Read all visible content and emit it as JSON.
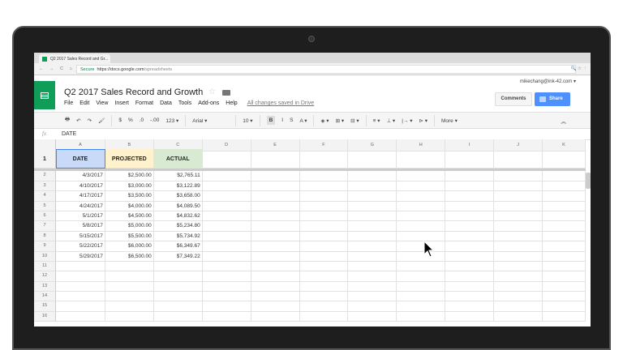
{
  "browser": {
    "tab_title": "Q2 2017 Sales Record and Gr...",
    "secure": "Secure",
    "url_host": "https://docs.google.com",
    "url_path": "/spreadsheets"
  },
  "doc": {
    "title": "Q2 2017 Sales Record and Growth",
    "user": "mikechang@ink-42.com ▾",
    "comments": "Comments",
    "share": "Share",
    "menu": [
      "File",
      "Edit",
      "View",
      "Insert",
      "Format",
      "Data",
      "Tools",
      "Add-ons",
      "Help"
    ],
    "saved": "All changes saved in Drive"
  },
  "toolbar": {
    "items": [
      "🖶",
      "↶",
      "↷",
      "🖌",
      "$",
      "%",
      ".0",
      "-.00",
      "123 ▾",
      "Arial ▾",
      "10 ▾",
      "B",
      "I",
      "S",
      "A ▾",
      "◈ ▾",
      "⊞ ▾",
      "⊟ ▾",
      "≡ ▾",
      "⊥ ▾",
      "|→ ▾",
      "⊳ ▾",
      "More ▾"
    ],
    "collapse": "︽"
  },
  "formula": {
    "fx": "fx",
    "value": "DATE"
  },
  "columns": [
    "A",
    "B",
    "C",
    "D",
    "E",
    "F",
    "G",
    "H",
    "I",
    "J",
    "K"
  ],
  "headers": [
    "DATE",
    "PROJECTED",
    "ACTUAL"
  ],
  "rows": [
    [
      "4/3/2017",
      "$2,500.00",
      "$2,765.11"
    ],
    [
      "4/10/2017",
      "$3,000.00",
      "$3,122.89"
    ],
    [
      "4/17/2017",
      "$3,500.00",
      "$3,658.00"
    ],
    [
      "4/24/2017",
      "$4,000.00",
      "$4,089.50"
    ],
    [
      "5/1/2017",
      "$4,500.00",
      "$4,832.62"
    ],
    [
      "5/8/2017",
      "$5,000.00",
      "$5,234.80"
    ],
    [
      "5/15/2017",
      "$5,500.00",
      "$5,734.92"
    ],
    [
      "5/22/2017",
      "$6,000.00",
      "$6,349.67"
    ],
    [
      "5/29/2017",
      "$6,500.00",
      "$7,349.22"
    ]
  ],
  "empty_row_numbers": [
    11,
    12,
    13,
    14,
    15,
    16
  ],
  "colors": {
    "selected": "#c9daf8",
    "projected": "#fff2cc",
    "actual": "#d9ead3",
    "brand": "#0f9d58",
    "share": "#4d90fe"
  }
}
